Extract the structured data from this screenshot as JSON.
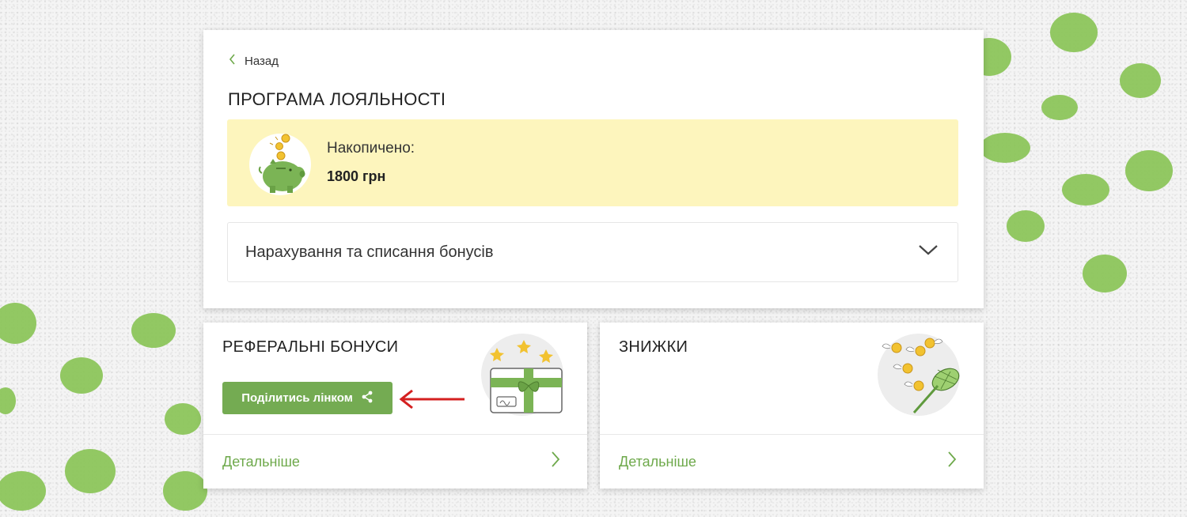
{
  "loyalty": {
    "back_label": "Назад",
    "title": "ПРОГРАМА ЛОЯЛЬНОСТІ",
    "balance_label": "Накопичено:",
    "balance_value": "1800 грн",
    "accordion_label": "Нарахування та списання бонусів"
  },
  "referral": {
    "title": "РЕФЕРАЛЬНІ БОНУСИ",
    "share_label": "Поділитись лінком",
    "details_label": "Детальніше"
  },
  "discounts": {
    "title": "ЗНИЖКИ",
    "details_label": "Детальніше"
  },
  "icons": {
    "back": "chevron-left-icon",
    "accordion": "chevron-down-icon",
    "details": "chevron-right-icon",
    "share": "share-icon",
    "balance": "piggy-bank-icon",
    "referral": "gift-card-icon",
    "discounts": "butterfly-net-coins-icon",
    "annotation": "red-arrow-icon"
  },
  "colors": {
    "accent_green": "#74ab52",
    "link_green": "#6ea94b",
    "balance_bg": "#fdf5bd",
    "annotation_red": "#d42020",
    "decor_green": "#8cc55b"
  }
}
